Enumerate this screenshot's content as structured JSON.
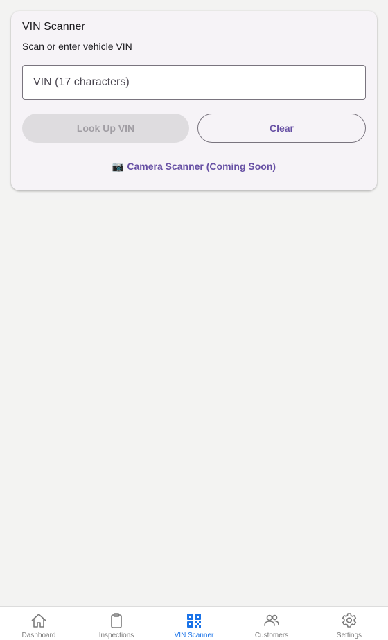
{
  "card": {
    "title": "VIN Scanner",
    "subtitle": "Scan or enter vehicle VIN",
    "vin_input": {
      "value": "",
      "placeholder": "VIN (17 characters)"
    },
    "lookup_button": "Look Up VIN",
    "clear_button": "Clear",
    "camera_icon": "📷",
    "camera_link": "Camera Scanner (Coming Soon)"
  },
  "nav": {
    "items": [
      {
        "label": "Dashboard",
        "icon": "home-icon",
        "active": false
      },
      {
        "label": "Inspections",
        "icon": "clipboard-icon",
        "active": false
      },
      {
        "label": "VIN Scanner",
        "icon": "qr-code-icon",
        "active": true
      },
      {
        "label": "Customers",
        "icon": "people-icon",
        "active": false
      },
      {
        "label": "Settings",
        "icon": "gear-icon",
        "active": false
      }
    ],
    "active_color": "#1a73e8",
    "inactive_color": "#7a7a7a"
  },
  "colors": {
    "accent": "#6750a4",
    "background": "#f3f3f2",
    "card_background": "#f6f3f7"
  }
}
